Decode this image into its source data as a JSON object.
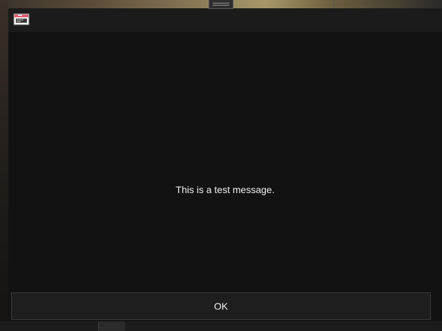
{
  "dialog": {
    "icon": "window-icon",
    "message": "This is a test message.",
    "ok_label": "OK"
  },
  "colors": {
    "dialog_background": "#121212",
    "titlebar_background": "#1b1b1b",
    "text": "#f2f2f2",
    "button_border": "#3c3c3c",
    "icon_accent": "#e05a6a"
  }
}
